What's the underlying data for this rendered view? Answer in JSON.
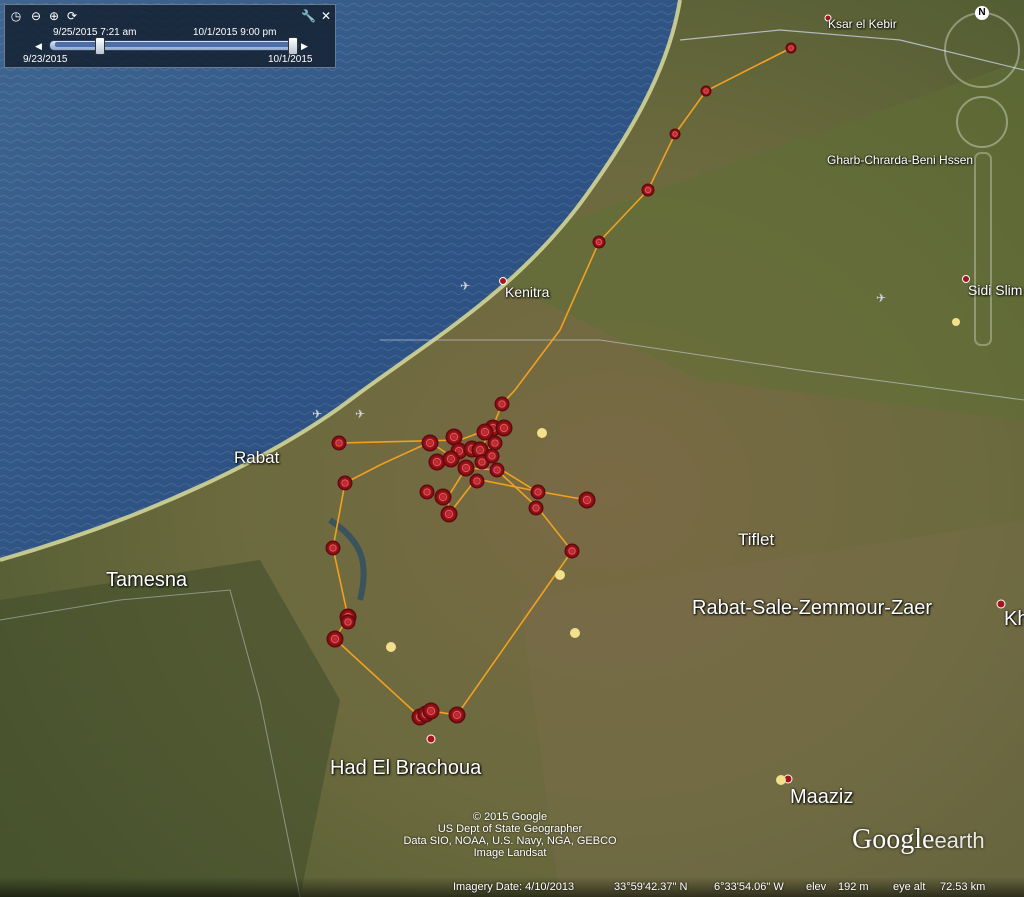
{
  "time_slider": {
    "begin_label": "9/25/2015   7:21 am",
    "end_label": "10/1/2015   9:00 pm",
    "range_start": "9/23/2015",
    "range_end": "10/1/2015"
  },
  "places": {
    "ksar": "Ksar el Kebir",
    "gharb": "Gharb-Chrarda-Beni Hssen",
    "kenitra": "Kenitra",
    "sidi": "Sidi Slim",
    "rabat": "Rabat",
    "tiflet": "Tiflet",
    "tamesna": "Tamesna",
    "region": "Rabat-Sale-Zemmour-Zaer",
    "kh": "Kh",
    "had": "Had El Brachoua",
    "maaziz": "Maaziz"
  },
  "credits": {
    "line1": "© 2015 Google",
    "line2": "US Dept of State Geographer",
    "line3": "Data SIO, NOAA, U.S. Navy, NGA, GEBCO",
    "line4": "Image Landsat"
  },
  "logo": {
    "google": "Google",
    "earth": "earth"
  },
  "status": {
    "imagery_date": "Imagery Date: 4/10/2013",
    "lat": "33°59'42.37\" N",
    "lon": "6°33'54.06\" W",
    "elev_label": "elev",
    "elev": "192 m",
    "eye_label": "eye alt",
    "eye_alt": "72.53 km"
  },
  "nav": {
    "north": "N"
  },
  "colors": {
    "track": "#f2a020",
    "marker": "#a5151b",
    "ocean": "#2b4f7c"
  }
}
